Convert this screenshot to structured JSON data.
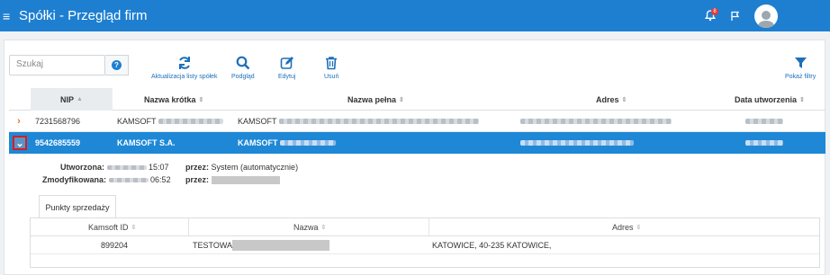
{
  "app": {
    "title": "Spółki - Przegląd firm",
    "notifications": "8"
  },
  "toolbar": {
    "search_placeholder": "Szukaj",
    "help_glyph": "?",
    "refresh_label": "Aktualizacja listy spółek",
    "preview_label": "Podgląd",
    "edit_label": "Edytuj",
    "delete_label": "Usuń",
    "filters_label": "Pokaż filtry"
  },
  "table": {
    "columns": [
      "NIP",
      "Nazwa krótka",
      "Nazwa pełna",
      "Adres",
      "Data utworzenia"
    ],
    "rows": [
      {
        "nip": "7231568796",
        "short": "KAMSOFT",
        "full": "KAMSOFT"
      },
      {
        "nip": "9542685559",
        "short": "KAMSOFT S.A.",
        "full": "KAMSOFT"
      }
    ]
  },
  "detail": {
    "created_label": "Utworzona:",
    "created_time": "15:07",
    "created_by_label": "przez:",
    "created_by": "System (automatycznie)",
    "modified_label": "Zmodyfikowana:",
    "modified_time": "06:52",
    "modified_by_label": "przez:"
  },
  "subtabs": {
    "active": "Punkty sprzedaży"
  },
  "pos_table": {
    "columns": [
      "Kamsoft ID",
      "Nazwa",
      "Adres"
    ],
    "rows": [
      {
        "id": "899204",
        "name": "TESTOWA",
        "address": "KATOWICE, 40-235 KATOWICE,"
      }
    ]
  },
  "colors": {
    "accent": "#1e7fd1",
    "selected_row": "#1e88d6",
    "expander": "#e8711a",
    "focus_border": "#d61e1e"
  }
}
